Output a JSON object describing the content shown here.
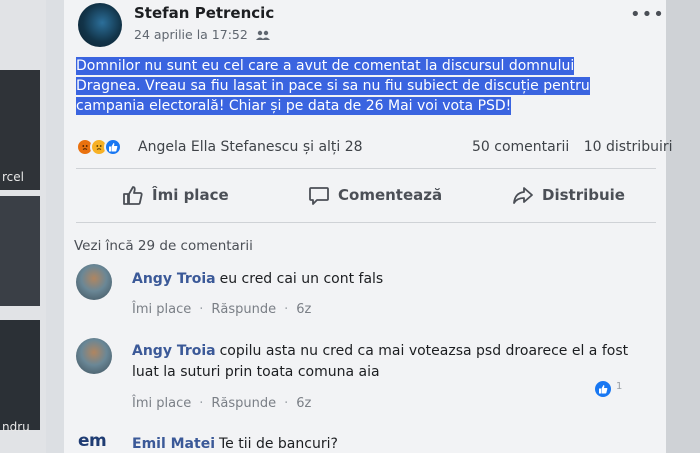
{
  "sidebar": {
    "labels": [
      "rcel",
      "ndru"
    ]
  },
  "post": {
    "author": "Stefan Petrencic",
    "timestamp": "24 aprilie la 17:52",
    "privacy_icon": "friends-icon",
    "more_label": "•••",
    "text": "Domnilor nu sunt eu cel care a avut de comentat la discursul domnului Dragnea. Vreau sa fiu lasat in pace si sa nu fiu subiect de discuție pentru campania electorală! Chiar și pe data de 26 Mai voi vota PSD!",
    "reaction_names": "Angela Ella Stefanescu și alți 28",
    "comments_count": "50 comentarii",
    "shares_count": "10 distribuiri",
    "actions": {
      "like": "Îmi place",
      "comment": "Comentează",
      "share": "Distribuie"
    }
  },
  "comments": {
    "more_label": "Vezi încă 29 de comentarii",
    "items": [
      {
        "name": "Angy Troia",
        "text": "eu cred cai un cont fals",
        "like": "Îmi place",
        "reply": "Răspunde",
        "age": "6z"
      },
      {
        "name": "Angy Troia",
        "text": "copilu asta nu cred ca mai voteazsa psd droarece el a fost luat la suturi prin toata comuna aia",
        "like": "Îmi place",
        "reply": "Răspunde",
        "age": "6z",
        "likes": "1"
      },
      {
        "name": "Emil Matei",
        "text": "Te tii de bancuri?",
        "avatar_text": "em"
      }
    ]
  },
  "colors": {
    "highlight": "#3a64e0",
    "link_name": "#3b5998",
    "like_blue": "#1877f2"
  }
}
